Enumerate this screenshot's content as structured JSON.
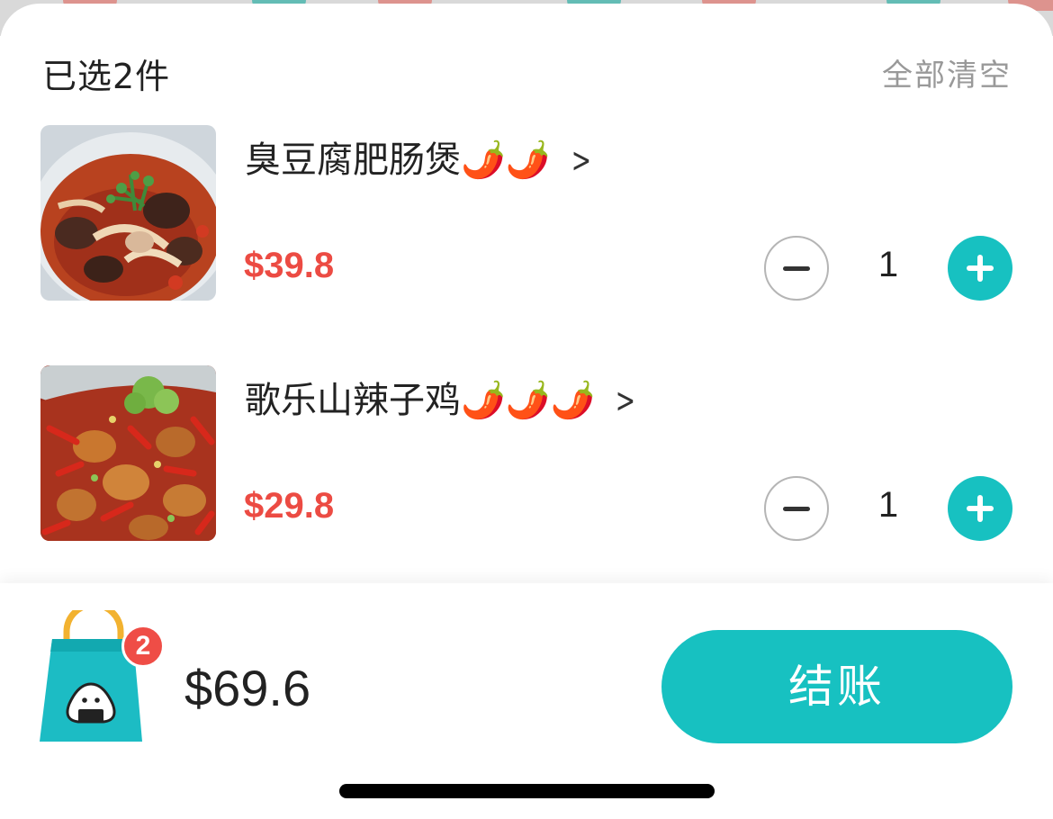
{
  "cart": {
    "selected_label": "已选2件",
    "clear_all_label": "全部清空"
  },
  "items": [
    {
      "name": "臭豆腐肥肠煲🌶️🌶️",
      "price": "$39.8",
      "quantity": "1",
      "spice_level": 2,
      "image": "dish-photo-stinky-tofu-intestine-pot"
    },
    {
      "name": "歌乐山辣子鸡🌶️🌶️🌶️",
      "price": "$29.8",
      "quantity": "1",
      "spice_level": 3,
      "image": "dish-photo-spicy-chicken"
    }
  ],
  "footer": {
    "badge_count": "2",
    "total": "$69.6",
    "checkout_label": "结账"
  },
  "icons": {
    "detail": "chevron-right-icon",
    "decrease": "minus-icon",
    "increase": "plus-icon",
    "cart": "shopping-bag-icon"
  },
  "colors": {
    "accent": "#17c1c1",
    "price": "#ec4b43",
    "badge": "#ef4d46",
    "muted_text": "#999999"
  }
}
